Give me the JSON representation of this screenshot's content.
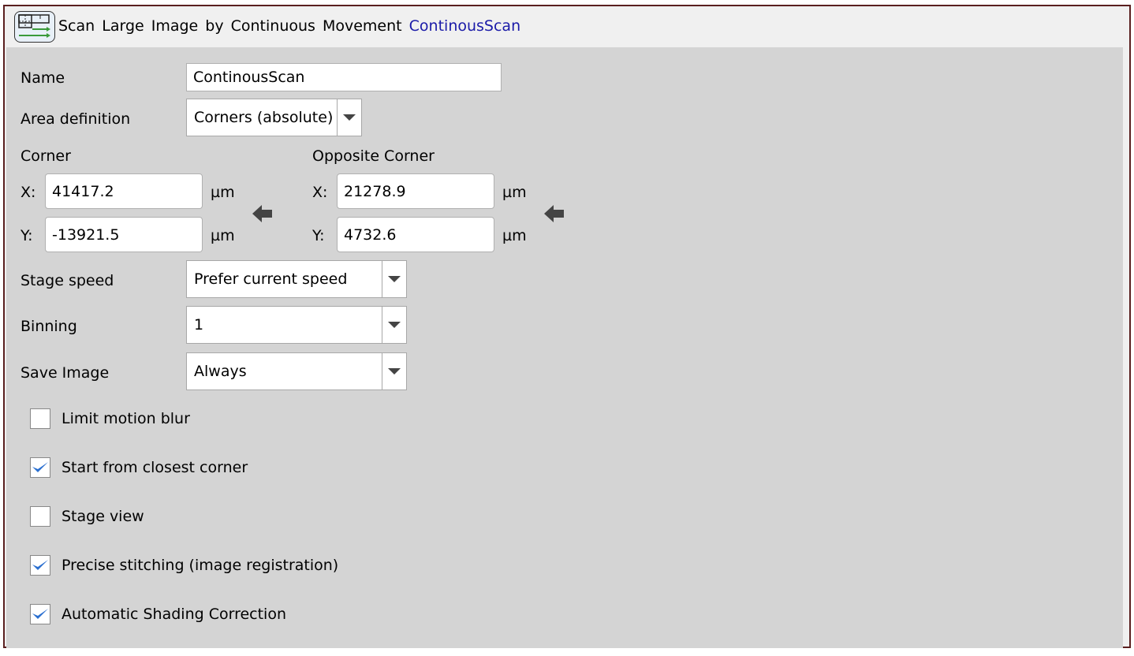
{
  "header": {
    "title": "Scan Large Image by Continuous Movement",
    "name": "ContinousScan",
    "icon": "scan-grid-icon"
  },
  "form": {
    "name_label": "Name",
    "name_value": "ContinousScan",
    "area_label": "Area definition",
    "area_value": "Corners (absolute)",
    "corner_label": "Corner",
    "opposite_label": "Opposite Corner",
    "x_label": "X:",
    "y_label": "Y:",
    "unit": "µm",
    "corner_x": "41417.2",
    "corner_y": "-13921.5",
    "opposite_x": "21278.9",
    "opposite_y": "4732.6",
    "speed_label": "Stage speed",
    "speed_value": "Prefer current speed",
    "binning_label": "Binning",
    "binning_value": "1",
    "save_label": "Save Image",
    "save_value": "Always"
  },
  "checkboxes": [
    {
      "label": "Limit motion blur",
      "checked": false
    },
    {
      "label": "Start from closest corner",
      "checked": true
    },
    {
      "label": "Stage view",
      "checked": false
    },
    {
      "label": "Precise stitching (image registration)",
      "checked": true
    },
    {
      "label": "Automatic Shading Correction",
      "checked": true
    }
  ],
  "colors": {
    "accent": "#2a6fd0",
    "title_name": "#1a1aa8",
    "frame": "#5a1f1f"
  }
}
